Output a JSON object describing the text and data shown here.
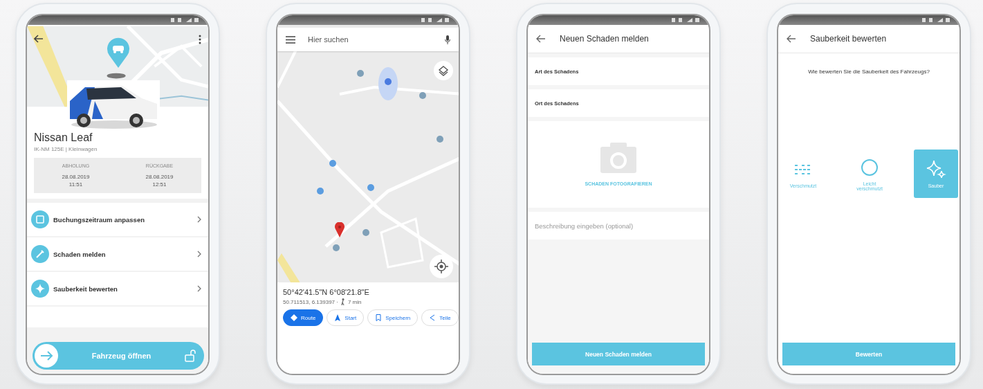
{
  "phones": [
    {
      "kind": "vehicle",
      "vehicle": {
        "name": "Nissan Leaf",
        "subtitle": "IK-NM 125E | Kleinwagen"
      },
      "booking": [
        {
          "label": "ABHOLUNG",
          "date": "28.08.2019",
          "time": "11:51"
        },
        {
          "label": "RÜCKGABE",
          "date": "28.08.2019",
          "time": "12:51"
        }
      ],
      "actions": [
        {
          "kind": "calendar",
          "label": "Buchungszeitraum anpassen"
        },
        {
          "kind": "damage",
          "label": "Schaden melden"
        },
        {
          "kind": "sparkle",
          "label": "Sauberkeit bewerten"
        }
      ],
      "open_button": "Fahrzeug öffnen"
    },
    {
      "kind": "map",
      "search": {
        "placeholder": "Hier suchen"
      },
      "place": {
        "coordinates": "50°42'41.5\"N 6°08'21.8\"E",
        "decimal": "50.711513, 6.139397 ·",
        "walk": "7 min"
      },
      "buttons": [
        {
          "kind": "route",
          "label": "Route",
          "selected": true
        },
        {
          "kind": "start",
          "label": "Start",
          "selected": false
        },
        {
          "kind": "save",
          "label": "Speichern",
          "selected": false
        },
        {
          "kind": "share",
          "label": "Teile",
          "selected": false
        }
      ]
    },
    {
      "kind": "damage",
      "title": "Neuen Schaden melden",
      "fields": [
        {
          "label": "Art des Schadens"
        },
        {
          "label": "Ort des Schadens"
        }
      ],
      "photo_action": "SCHADEN FOTOGRAFIEREN",
      "description": {
        "placeholder": "Beschreibung eingeben (optional)"
      },
      "submit": "Neuen Schaden melden"
    },
    {
      "kind": "rating",
      "title": "Sauberkeit bewerten",
      "question": "Wie bewerten Sie die Sauberkeit des Fahrzeugs?",
      "options": [
        {
          "kind": "dirty",
          "label": "Verschmutzt",
          "selected": false
        },
        {
          "kind": "light",
          "label": "Leicht verschmutzt",
          "selected": false
        },
        {
          "kind": "clean",
          "label": "Sauber",
          "selected": true
        }
      ],
      "submit": "Bewerten"
    }
  ]
}
